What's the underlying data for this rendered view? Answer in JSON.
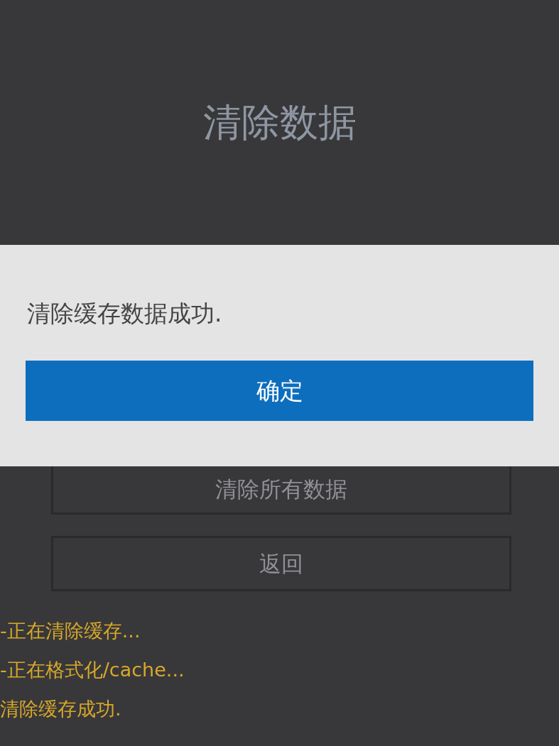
{
  "page_title": "清除数据",
  "dialog": {
    "message": "清除缓存数据成功.",
    "button": "确定"
  },
  "buttons": [
    "清除所有数据",
    "返回"
  ],
  "log": [
    "-正在清除缓存...",
    "-正在格式化/cache...",
    "清除缓存成功."
  ]
}
